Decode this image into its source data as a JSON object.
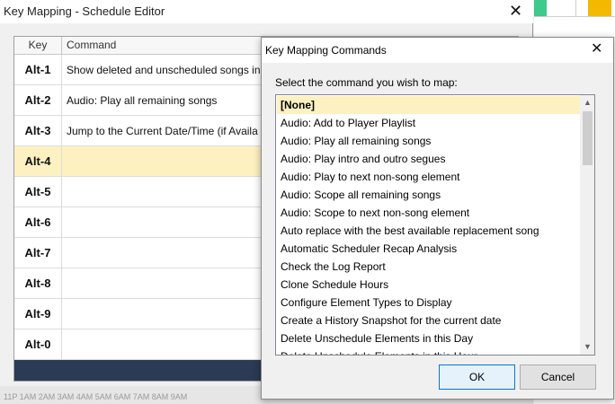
{
  "schedule_editor": {
    "title": "Key Mapping - Schedule Editor",
    "close_glyph": "✕",
    "columns": {
      "key": "Key",
      "command": "Command"
    },
    "rows": [
      {
        "key": "Alt-1",
        "command": "Show deleted and unscheduled songs in"
      },
      {
        "key": "Alt-2",
        "command": "Audio: Play all remaining songs"
      },
      {
        "key": "Alt-3",
        "command": "Jump to the Current Date/Time (if Availa"
      },
      {
        "key": "Alt-4",
        "command": ""
      },
      {
        "key": "Alt-5",
        "command": ""
      },
      {
        "key": "Alt-6",
        "command": ""
      },
      {
        "key": "Alt-7",
        "command": ""
      },
      {
        "key": "Alt-8",
        "command": ""
      },
      {
        "key": "Alt-9",
        "command": ""
      },
      {
        "key": "Alt-0",
        "command": ""
      }
    ],
    "selected_row": 3,
    "footer_color": "#2b3a55",
    "bottom_strip": "11P   1AM   2AM   3AM   4AM   5AM   6AM   7AM   8AM   9AM"
  },
  "dialog": {
    "title": "Key Mapping Commands",
    "close_glyph": "✕",
    "prompt": "Select the command you wish to map:",
    "items": [
      "[None]",
      "Audio: Add to Player Playlist",
      "Audio: Play all remaining songs",
      "Audio: Play intro and outro segues",
      "Audio: Play to next non-song element",
      "Audio: Scope all remaining songs",
      "Audio: Scope to next non-song element",
      "Auto replace with the best available replacement song",
      "Automatic Scheduler Recap Analysis",
      "Check the Log Report",
      "Clone Schedule Hours",
      "Configure Element Types to Display",
      "Create a History Snapshot for the current date",
      "Delete Unschedule Elements in this Day",
      "Delete Unschedule Elements in this Hour"
    ],
    "selected_item": 0,
    "scroll_up_glyph": "▲",
    "scroll_down_glyph": "▼",
    "ok_label": "OK",
    "cancel_label": "Cancel",
    "selection_color": "#fdf1c2"
  }
}
